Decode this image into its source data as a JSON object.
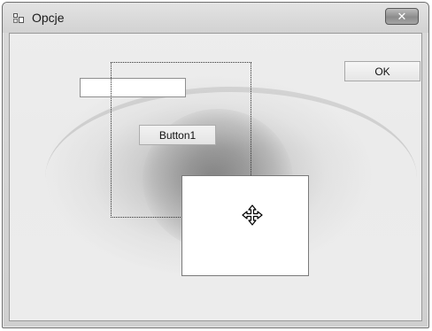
{
  "window": {
    "title": "Opcje",
    "icon": "form-icon",
    "close_label": "✕"
  },
  "form": {
    "ok_label": "OK",
    "button1_label": "Button1",
    "textbox_value": "",
    "background_image": "eye-photo"
  },
  "cursor": "move-cursor"
}
